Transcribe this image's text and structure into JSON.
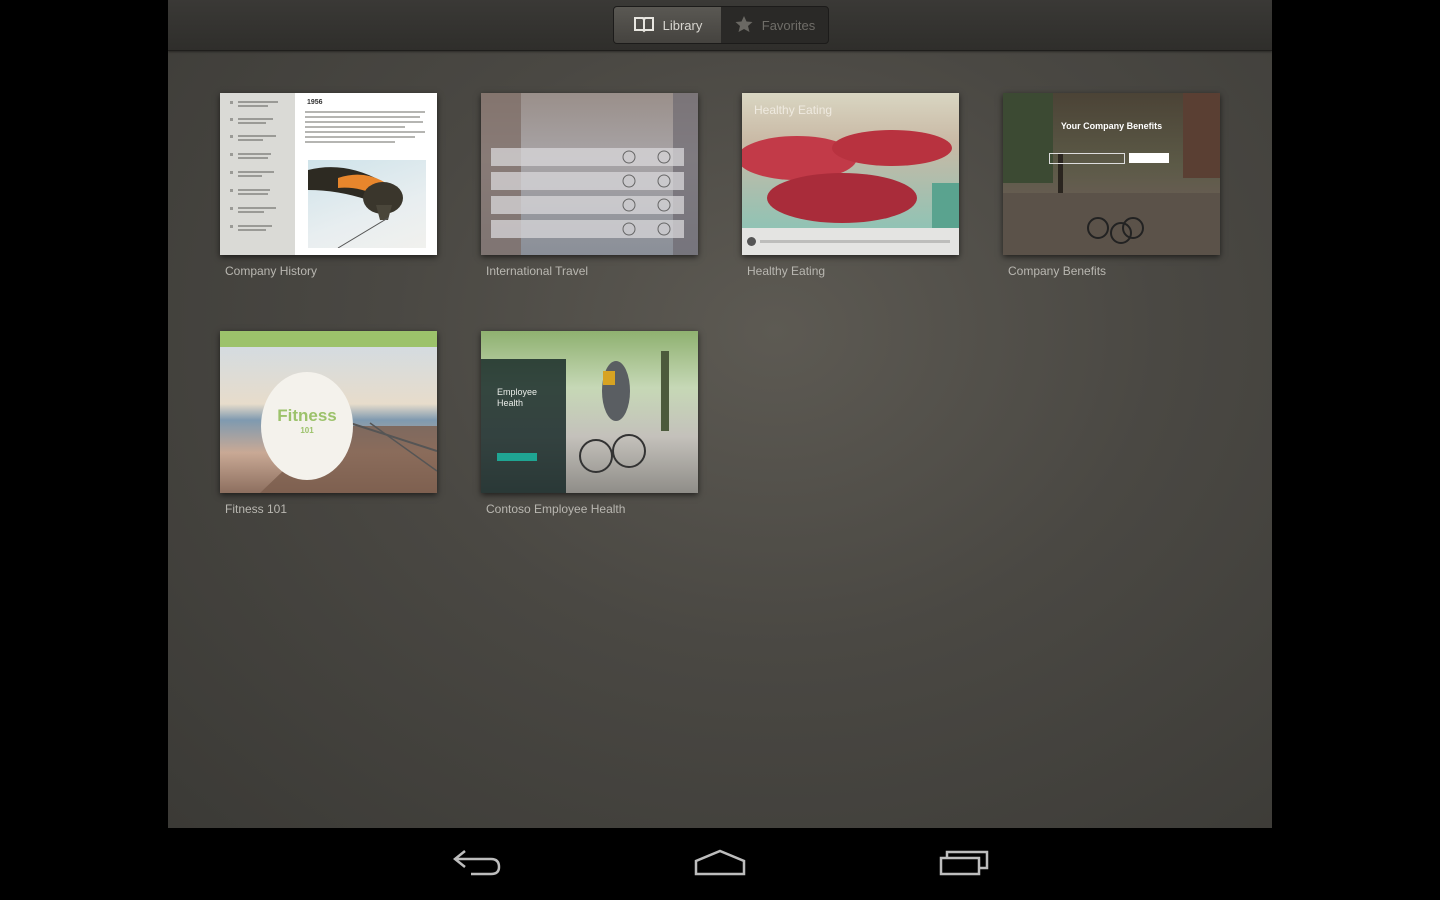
{
  "header": {
    "tabs": [
      {
        "label": "Library",
        "icon": "book-icon",
        "active": true
      },
      {
        "label": "Favorites",
        "icon": "star-icon",
        "active": false
      }
    ]
  },
  "library": {
    "items": [
      {
        "title": "Company History",
        "thumb_title": "1956"
      },
      {
        "title": "International Travel"
      },
      {
        "title": "Healthy Eating",
        "thumb_title": "Healthy Eating"
      },
      {
        "title": "Company Benefits",
        "thumb_title": "Your Company Benefits"
      },
      {
        "title": "Fitness 101",
        "thumb_title": "Fitness",
        "thumb_subtitle": "101"
      },
      {
        "title": "Contoso Employee Health",
        "thumb_title": "Employee Health"
      }
    ]
  },
  "navigation": {
    "buttons": [
      {
        "name": "back",
        "icon": "back-arrow-icon"
      },
      {
        "name": "home",
        "icon": "home-icon"
      },
      {
        "name": "recent-apps",
        "icon": "recent-apps-icon"
      }
    ]
  },
  "colors": {
    "background": "#4a4843",
    "topbar": "#33322f",
    "label_text": "#b9b7b1",
    "accent_teal": "#1fa593",
    "fitness_green": "#9cc26b"
  }
}
